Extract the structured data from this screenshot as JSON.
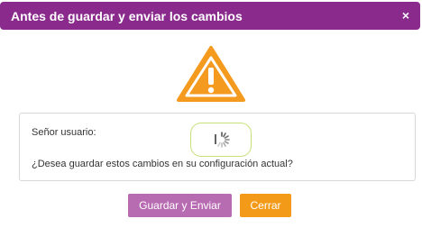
{
  "dialog": {
    "title": "Antes de guardar y enviar los cambios",
    "close_symbol": "×"
  },
  "icon": {
    "name": "warning-triangle-icon",
    "color": "#f49a1e"
  },
  "message": {
    "greeting": "Señor usuario:",
    "question": "¿Desea guardar estos cambios en su configuración actual?"
  },
  "buttons": {
    "primary_label": "Guardar y Enviar",
    "secondary_label": "Cerrar"
  },
  "colors": {
    "title_bar": "#8a2a8c",
    "primary_button": "#b76bb0",
    "secondary_button": "#f39a18",
    "spinner_border": "#c8e07c"
  }
}
